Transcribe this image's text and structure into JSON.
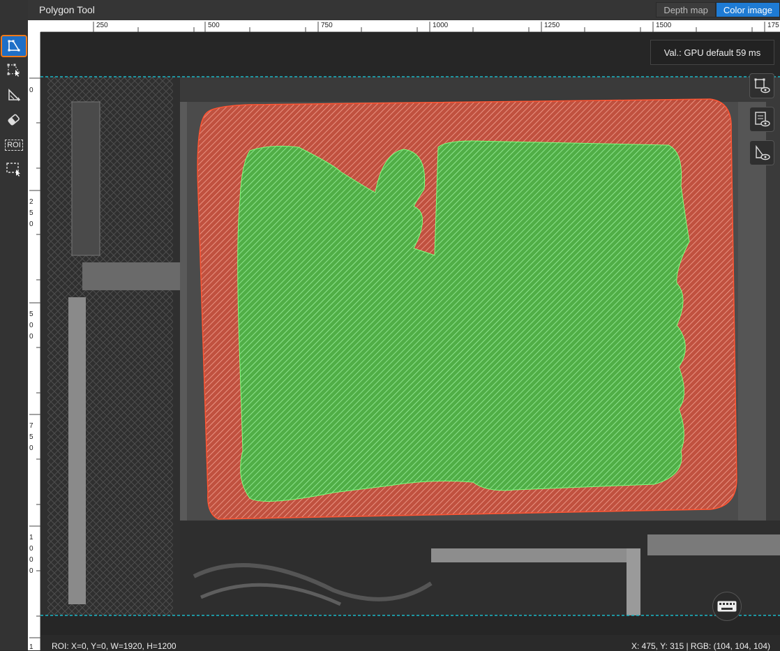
{
  "window": {
    "title": "Polygon Tool"
  },
  "view_toggle": {
    "depth_label": "Depth map",
    "color_label": "Color image",
    "active": "Color image"
  },
  "toolbar": {
    "tools": [
      {
        "name": "polygon-tool",
        "icon": "polygon-icon",
        "active": true
      },
      {
        "name": "point-edit-tool",
        "icon": "point-edit-icon",
        "active": false
      },
      {
        "name": "depth-tool",
        "icon": "depth-shape-icon",
        "active": false
      },
      {
        "name": "eraser-tool",
        "icon": "eraser-icon",
        "active": false
      },
      {
        "name": "roi-tool",
        "icon": "roi-icon",
        "label": "ROI",
        "active": false
      },
      {
        "name": "roi-select-tool",
        "icon": "roi-select-icon",
        "active": false
      }
    ]
  },
  "ruler": {
    "top_ticks": [
      "250",
      "500",
      "750",
      "1000",
      "1250",
      "1500",
      "175"
    ],
    "left_ticks": [
      [
        "0"
      ],
      [
        "2",
        "5",
        "0"
      ],
      [
        "5",
        "0",
        "0"
      ],
      [
        "7",
        "5",
        "0"
      ],
      [
        "1",
        "0",
        "0",
        "0"
      ],
      [
        "1"
      ]
    ]
  },
  "overlay": {
    "val_label": "Val.:",
    "val_text": "GPU default 59 ms",
    "side_buttons": [
      "polygon-view-icon",
      "checklist-view-icon",
      "depth-view-icon"
    ],
    "keyboard_icon": "keyboard-icon"
  },
  "status": {
    "roi": "ROI: X=0, Y=0, W=1920, H=1200",
    "cursor": "X: 475, Y: 315 | RGB: (104, 104, 104)"
  },
  "colors": {
    "accent": "#1e7bd4",
    "active_outline": "#f07a1a",
    "roi_line": "#1ab8c8",
    "region_red": "#e0503a",
    "region_green": "#3ec94a"
  }
}
